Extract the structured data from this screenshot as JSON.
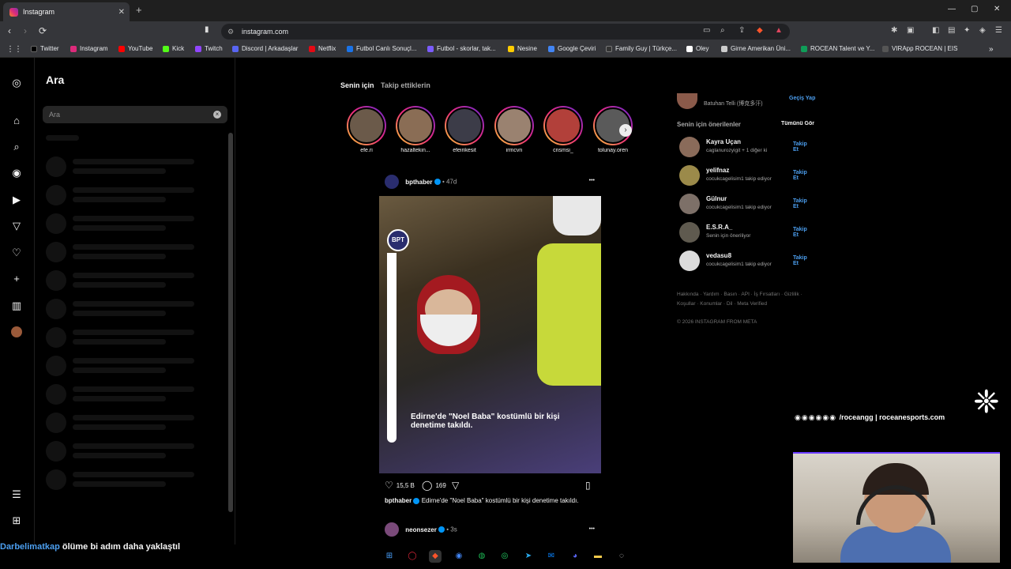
{
  "browser": {
    "tab_title": "Instagram",
    "tab_close": "✕",
    "new_tab": "+",
    "url": "instagram.com",
    "window_controls": [
      "—",
      "▢",
      "✕"
    ]
  },
  "bookmarks": [
    {
      "label": "Twitter",
      "color": "#000000"
    },
    {
      "label": "Instagram",
      "color": "#dd2a7b"
    },
    {
      "label": "YouTube",
      "color": "#ff0000"
    },
    {
      "label": "Kick",
      "color": "#53fc18"
    },
    {
      "label": "Twitch",
      "color": "#9146ff"
    },
    {
      "label": "Discord | Arkadaşlar",
      "color": "#5865f2"
    },
    {
      "label": "Netflix",
      "color": "#e50914"
    },
    {
      "label": "Futbol Canlı Sonuçl...",
      "color": "#1a73e8"
    },
    {
      "label": "Futbol - skorlar, tak...",
      "color": "#7b5cff"
    },
    {
      "label": "Nesine",
      "color": "#ffcc00"
    },
    {
      "label": "Google Çeviri",
      "color": "#4285f4"
    },
    {
      "label": "Family Guy | Türkçe...",
      "color": "#333333"
    },
    {
      "label": "Oley",
      "color": "#ffffff"
    },
    {
      "label": "Girne Amerikan Üni...",
      "color": "#cccccc"
    },
    {
      "label": "ROCEAN Talent ve Y...",
      "color": "#0f9d58"
    },
    {
      "label": "VIRApp ROCEAN | EIS",
      "color": "#555555"
    }
  ],
  "search_panel": {
    "title": "Ara",
    "placeholder": "Ara",
    "clear": "×"
  },
  "feed": {
    "tabs": [
      "Senin için",
      "Takip ettiklerin"
    ],
    "stories": [
      "efe.ri",
      "hazaltekin...",
      "efeirikesit",
      "irmcvn",
      "cnsmsi_",
      "tolunay.oren"
    ],
    "story_colors": [
      "#6b5a4a",
      "#8a6d55",
      "#3c3c48",
      "#9a8270",
      "#b2403a",
      "#5a5a5a"
    ],
    "story_next": "›",
    "post": {
      "username": "bpthaber",
      "age": "• 47d",
      "more": "•••",
      "badge": "BPT",
      "overlay_text": "Edirne'de \"Noel Baba\" kostümlü bir kişi denetime takıldı.",
      "likes": "15,5 B",
      "comments": "169",
      "caption_user": "bpthaber",
      "caption_text": "Edirne'de \"Noel Baba\" kostümlü bir kişi denetime takıldı."
    },
    "next_post": {
      "username": "neonsezer",
      "age": "• 3s",
      "more": "•••"
    }
  },
  "suggestions": {
    "current_user": {
      "name": "Batuhan Telli (博克多汗)",
      "switch": "Geçiş Yap"
    },
    "title": "Senin için önerilenler",
    "see_all": "Tümünü Gör",
    "items": [
      {
        "username": "Kayra Uçan",
        "sub": "caglanurozyigit + 1 diğer ki",
        "follow": "Takip Et",
        "color": "#8a6b5a"
      },
      {
        "username": "yelifnaz",
        "sub": "cocukcagelisim1 takip ediyor",
        "follow": "Takip Et",
        "color": "#9b8a4a"
      },
      {
        "username": "Gülnur",
        "sub": "cocukcagelisim1 takip ediyor",
        "follow": "Takip Et",
        "color": "#7d7068"
      },
      {
        "username": "E.S.R.A_",
        "sub": "Senin için öneriliyor",
        "follow": "Takip Et",
        "color": "#5f5a4f"
      },
      {
        "username": "vedasu8",
        "sub": "cocukcagelisim1 takip ediyor",
        "follow": "Takip Et",
        "color": "#dbdbdb"
      }
    ],
    "footer_links": "Hakkında · Yardım · Basın · API · İş Fırsatları · Gizlilik · Koşullar · Konumlar · Dil · Meta Verified",
    "copyright": "© 2026 INSTAGRAM FROM META"
  },
  "overlay": {
    "socials": "/roceangg | roceanesports.com",
    "ticker_highlight": "Darbelimatkap",
    "ticker_text": "ölüme bi adım daha yaklaştıl"
  }
}
